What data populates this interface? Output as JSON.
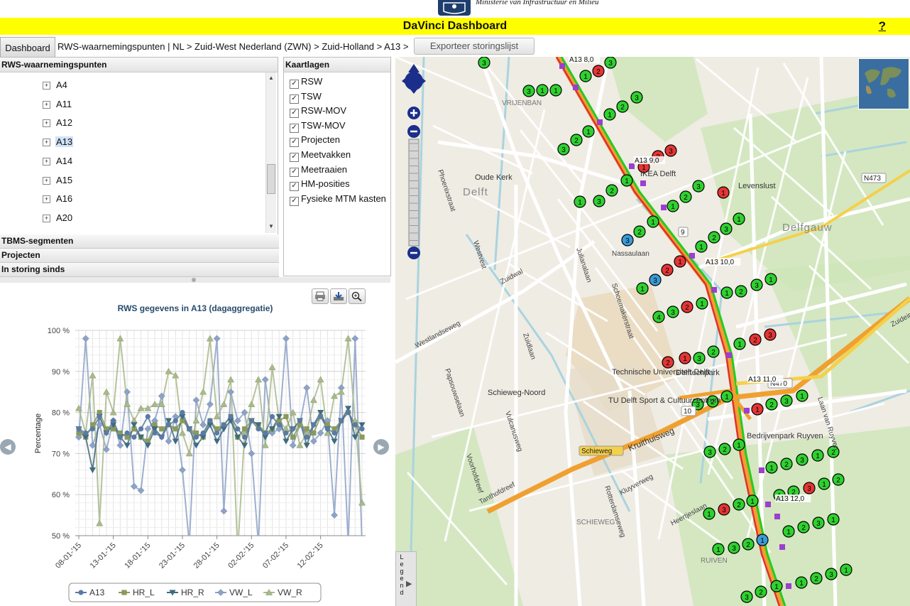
{
  "header": {
    "ministry": "Ministerie van Infrastructuur en Milieu",
    "title": "DaVinci Dashboard",
    "help": "?"
  },
  "nav": {
    "dashboard_tab": "Dashboard",
    "breadcrumb": "RWS-waarnemingspunten | NL > Zuid-West Nederland (ZWN) > Zuid-Holland > A13 >",
    "export_button": "Exporteer storingslijst"
  },
  "tree_panel": {
    "title": "RWS-waarnemingspunten",
    "items": [
      {
        "label": "A4"
      },
      {
        "label": "A11"
      },
      {
        "label": "A12"
      },
      {
        "label": "A13",
        "selected": true
      },
      {
        "label": "A14"
      },
      {
        "label": "A15"
      },
      {
        "label": "A16"
      },
      {
        "label": "A20"
      }
    ]
  },
  "collapsed_panels": [
    "TBMS-segmenten",
    "Projecten",
    "In storing sinds"
  ],
  "layers_panel": {
    "title": "Kaartlagen",
    "layers": [
      {
        "label": "RSW",
        "checked": true
      },
      {
        "label": "TSW",
        "checked": true
      },
      {
        "label": "RSW-MOV",
        "checked": true
      },
      {
        "label": "TSW-MOV",
        "checked": true
      },
      {
        "label": "Projecten",
        "checked": true
      },
      {
        "label": "Meetvakken",
        "checked": true
      },
      {
        "label": "Meetraaien",
        "checked": true
      },
      {
        "label": "HM-posities",
        "checked": true
      },
      {
        "label": "Fysieke MTM kasten",
        "checked": true
      }
    ]
  },
  "chart_toolbar": [
    "print-icon",
    "download-icon",
    "zoom-icon"
  ],
  "chart_data": {
    "type": "line",
    "title": "RWS gegevens in A13 (dagaggregatie)",
    "ylabel": "Percentage",
    "ylim": [
      50,
      100
    ],
    "yticks": [
      "50 %",
      "60 %",
      "70 %",
      "80 %",
      "90 %",
      "100 %"
    ],
    "xticks": [
      "08-01-'15",
      "13-01-'15",
      "18-01-'15",
      "23-01-'15",
      "28-01-'15",
      "02-02-'15",
      "07-02-'15",
      "12-02-'15"
    ],
    "n_days": 42,
    "series": [
      {
        "name": "A13",
        "color": "#5a7aa6",
        "marker": "circle",
        "values": [
          76,
          75,
          76,
          79,
          75,
          78,
          74,
          75,
          74,
          76,
          79,
          75,
          74,
          77,
          78,
          80,
          76,
          74,
          75,
          78,
          75,
          77,
          79,
          76,
          74,
          78,
          76,
          75,
          79,
          77,
          75,
          76,
          78,
          74,
          77,
          79,
          76,
          75,
          78,
          80,
          77,
          76
        ]
      },
      {
        "name": "HR_L",
        "color": "#8a9a5b",
        "marker": "square",
        "values": [
          75,
          74,
          77,
          80,
          76,
          76,
          75,
          74,
          76,
          74,
          73,
          77,
          76,
          77,
          76,
          78,
          76,
          75,
          74,
          78,
          76,
          77,
          79,
          74,
          76,
          78,
          77,
          75,
          76,
          78,
          79,
          74,
          77,
          76,
          75,
          79,
          77,
          76,
          78,
          80,
          77,
          74
        ]
      },
      {
        "name": "HR_R",
        "color": "#3f6b80",
        "marker": "triangle-down",
        "values": [
          76,
          74,
          66,
          79,
          75,
          77,
          74,
          72,
          77,
          74,
          72,
          76,
          74,
          78,
          73,
          79,
          76,
          72,
          74,
          77,
          73,
          76,
          78,
          74,
          72,
          78,
          77,
          74,
          76,
          79,
          73,
          76,
          78,
          72,
          77,
          80,
          76,
          73,
          78,
          81,
          74,
          77
        ]
      },
      {
        "name": "VW_L",
        "color": "#8da2c7",
        "marker": "diamond",
        "values": [
          74,
          98,
          72,
          77,
          71,
          78,
          72,
          85,
          62,
          61,
          76,
          78,
          84,
          73,
          79,
          66,
          48,
          83,
          77,
          82,
          98,
          56,
          85,
          78,
          80,
          70,
          48,
          88,
          75,
          76,
          98,
          72,
          77,
          86,
          73,
          75,
          78,
          55,
          86,
          48,
          98,
          48
        ]
      },
      {
        "name": "VW_R",
        "color": "#a9b98c",
        "marker": "triangle",
        "values": [
          81,
          75,
          89,
          53,
          85,
          80,
          98,
          82,
          78,
          81,
          81,
          82,
          82,
          90,
          89,
          75,
          70,
          78,
          85,
          98,
          79,
          82,
          88,
          46,
          75,
          82,
          88,
          72,
          91,
          78,
          76,
          80,
          72,
          75,
          83,
          88,
          75,
          84,
          85,
          98,
          78,
          58
        ]
      }
    ]
  },
  "map": {
    "labels": [
      {
        "text": "Delft",
        "kind": "city"
      },
      {
        "text": "Delfgauw",
        "kind": "city"
      },
      {
        "text": "Oude Kerk",
        "kind": "poi"
      },
      {
        "text": "IKEA Delft",
        "kind": "poi"
      },
      {
        "text": "Levenslust",
        "kind": "poi"
      },
      {
        "text": "Technische Universiteit Delft",
        "kind": "poi"
      },
      {
        "text": "Delftechpark",
        "kind": "poi"
      },
      {
        "text": "TU Delft Sport & Cultuurcentrum",
        "kind": "poi"
      },
      {
        "text": "Schieweg-Noord",
        "kind": "poi"
      },
      {
        "text": "Bedrijvenpark Ruyven",
        "kind": "poi"
      },
      {
        "text": "Kruithuisweg",
        "kind": "road"
      },
      {
        "text": "Rotterdamseweg",
        "kind": "road"
      },
      {
        "text": "Schoemakerstraat",
        "kind": "road"
      },
      {
        "text": "Westlandseweg",
        "kind": "road"
      },
      {
        "text": "Nassaulaan",
        "kind": "road"
      },
      {
        "text": "Julianalaan",
        "kind": "road"
      },
      {
        "text": "Phoenixstraat",
        "kind": "road"
      },
      {
        "text": "Westvest",
        "kind": "road"
      },
      {
        "text": "Zuidwal",
        "kind": "road"
      },
      {
        "text": "Papsouwselaan",
        "kind": "road"
      },
      {
        "text": "Laan van Ruyven",
        "kind": "road"
      },
      {
        "text": "Zuideindseweg",
        "kind": "road"
      },
      {
        "text": "Heertjeslaan",
        "kind": "road"
      },
      {
        "text": "Kluyverweg",
        "kind": "road"
      },
      {
        "text": "Tanthofdreef",
        "kind": "road"
      },
      {
        "text": "Voorhofdreef",
        "kind": "road"
      },
      {
        "text": "Vulcanusweg",
        "kind": "road"
      },
      {
        "text": "Zuidlaan",
        "kind": "road"
      },
      {
        "text": "Schieweg",
        "kind": "road"
      },
      {
        "text": "SCHIEWEG",
        "kind": "area"
      },
      {
        "text": "RUIVEN",
        "kind": "area"
      },
      {
        "text": "VRIJENBAN",
        "kind": "area"
      },
      {
        "text": "N473",
        "kind": "shield"
      },
      {
        "text": "N470",
        "kind": "shield"
      },
      {
        "text": "9",
        "kind": "shield"
      },
      {
        "text": "10",
        "kind": "shield"
      },
      {
        "text": "A13 8,0",
        "kind": "hm"
      },
      {
        "text": "A13 9,0",
        "kind": "hm"
      },
      {
        "text": "A13 10,0",
        "kind": "hm"
      },
      {
        "text": "A13 11,0",
        "kind": "hm"
      },
      {
        "text": "A13 12,0",
        "kind": "hm"
      }
    ],
    "legend_tab": "Legend"
  },
  "colors": {
    "accent_yellow": "#ffff00",
    "status_ok": "#2ecc40",
    "status_error": "#e83030",
    "status_info": "#3b9ad9",
    "hm_marker": "#9b3fd0"
  }
}
